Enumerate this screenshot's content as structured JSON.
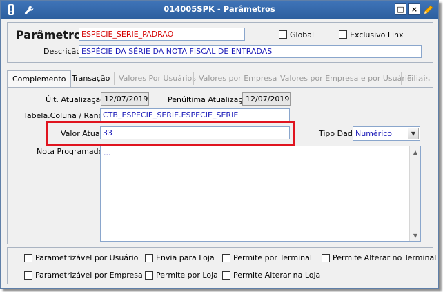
{
  "window": {
    "title": "014005SPK - Parâmetros",
    "controls": {
      "restore": "□",
      "close": "×"
    }
  },
  "header": {
    "parametro_label": "Parâmetro",
    "parametro_value": "ESPECIE_SERIE_PADRAO",
    "global_label": "Global",
    "exclusivo_label": "Exclusivo Linx",
    "descricao_label": "Descrição",
    "descricao_value": "ESPÉCIE DA SÉRIE DA NOTA FISCAL DE ENTRADAS"
  },
  "tabs": [
    {
      "label": "Complemento",
      "state": "active"
    },
    {
      "label": "Transação",
      "state": "enabled"
    },
    {
      "label": "Valores Por Usuários",
      "state": "disabled"
    },
    {
      "label": "Valores por Empresa",
      "state": "disabled"
    },
    {
      "label": "Valores por Empresa e por Usuário",
      "state": "disabled"
    },
    {
      "label": "Filiais",
      "state": "disabled"
    }
  ],
  "complemento": {
    "ult_atualizacao_label": "Últ. Atualização",
    "ult_atualizacao_value": "12/07/2019",
    "penultima_label": "Penúltima Atualização",
    "penultima_value": "12/07/2019",
    "tabela_label": "Tabela.Coluna / Range",
    "tabela_value": "CTB_ESPECIE_SERIE.ESPECIE_SERIE",
    "valor_atual_label": "Valor Atual",
    "valor_atual_value": "33",
    "tipo_dado_label": "Tipo Dado",
    "tipo_dado_value": "Numérico",
    "nota_label": "Nota Programador",
    "nota_value": "..."
  },
  "options": {
    "param_usuario": "Parametrizável por Usuário",
    "envia_loja": "Envia para Loja",
    "permite_terminal": "Permite por Terminal",
    "permite_alterar_terminal": "Permite Alterar no Terminal",
    "param_empresa": "Parametrizável por Empresa",
    "permite_loja": "Permite por Loja",
    "permite_alterar_loja": "Permite Alterar na Loja"
  },
  "colors": {
    "titlebar": "#2d5f9f",
    "highlight": "#e0141f",
    "required_text": "#d40000",
    "value_text": "#1a1ab8"
  },
  "icons": [
    "traffic-light-icon",
    "wrench-icon",
    "restore-icon",
    "close-icon",
    "pencil-icon",
    "chevron-down-icon"
  ]
}
